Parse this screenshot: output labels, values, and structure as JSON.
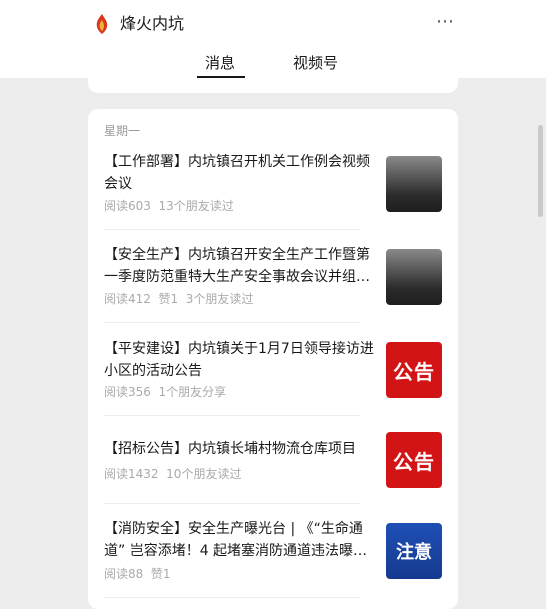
{
  "account": {
    "name": "烽火内坑"
  },
  "tabs": {
    "messages": "消息",
    "video": "视频号"
  },
  "day_label": "星期一",
  "articles": [
    {
      "title": "【工作部署】内坑镇召开机关工作例会视频会议",
      "meta": "阅读603  13个朋友读过",
      "thumb": "photo"
    },
    {
      "title": "【安全生产】内坑镇召开安全生产工作暨第一季度防范重特大生产安全事故会议并组…",
      "meta": "阅读412  赞1  3个朋友读过",
      "thumb": "photo"
    },
    {
      "title": "【平安建设】内坑镇关于1月7日领导接访进小区的活动公告",
      "meta": "阅读356  1个朋友分享",
      "thumb": "公告"
    },
    {
      "title": "【招标公告】内坑镇长埔村物流仓库项目",
      "meta": "阅读1432  10个朋友读过",
      "thumb": "公告"
    },
    {
      "title": "【消防安全】安全生产曝光台 | 《“生命通道” 岂容添堵！4 起堵塞消防通道违法曝…",
      "meta": "阅读88  赞1",
      "thumb": "注意"
    }
  ]
}
